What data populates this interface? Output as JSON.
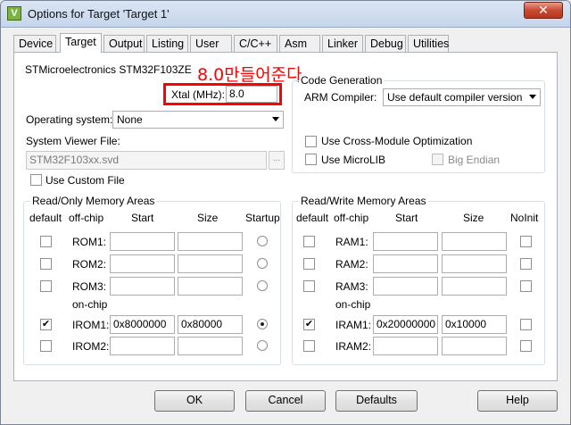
{
  "window": {
    "title": "Options for Target 'Target 1'",
    "close_label": "✕"
  },
  "tabs": [
    "Device",
    "Target",
    "Output",
    "Listing",
    "User",
    "C/C++",
    "Asm",
    "Linker",
    "Debug",
    "Utilities"
  ],
  "active_tab": "Target",
  "device": "STMicroelectronics STM32F103ZE",
  "annotation": "8.0만들어준다",
  "xtal": {
    "label": "Xtal (MHz):",
    "value": "8.0"
  },
  "os": {
    "label": "Operating system:",
    "value": "None"
  },
  "svd": {
    "label": "System Viewer File:",
    "value": "STM32F103xx.svd",
    "browse_label": "..."
  },
  "custom_file_label": "Use Custom File",
  "codegen": {
    "title": "Code Generation",
    "compiler_label": "ARM Compiler:",
    "compiler_value": "Use default compiler version",
    "cross_module_label": "Use Cross-Module Optimization",
    "microlib_label": "Use MicroLIB",
    "big_endian_label": "Big Endian"
  },
  "ro_memory": {
    "title": "Read/Only Memory Areas",
    "headers": {
      "default": "default",
      "offchip": "off-chip",
      "start": "Start",
      "size": "Size",
      "extra": "Startup"
    },
    "onchip_label": "on-chip",
    "rows": [
      {
        "name": "ROM1:",
        "start": "",
        "size": "",
        "default": false,
        "selected": false
      },
      {
        "name": "ROM2:",
        "start": "",
        "size": "",
        "default": false,
        "selected": false
      },
      {
        "name": "ROM3:",
        "start": "",
        "size": "",
        "default": false,
        "selected": false
      },
      {
        "name": "IROM1:",
        "start": "0x8000000",
        "size": "0x80000",
        "default": true,
        "selected": true
      },
      {
        "name": "IROM2:",
        "start": "",
        "size": "",
        "default": false,
        "selected": false
      }
    ]
  },
  "rw_memory": {
    "title": "Read/Write Memory Areas",
    "headers": {
      "default": "default",
      "offchip": "off-chip",
      "start": "Start",
      "size": "Size",
      "extra": "NoInit"
    },
    "onchip_label": "on-chip",
    "rows": [
      {
        "name": "RAM1:",
        "start": "",
        "size": "",
        "default": false,
        "noinit": false
      },
      {
        "name": "RAM2:",
        "start": "",
        "size": "",
        "default": false,
        "noinit": false
      },
      {
        "name": "RAM3:",
        "start": "",
        "size": "",
        "default": false,
        "noinit": false
      },
      {
        "name": "IRAM1:",
        "start": "0x20000000",
        "size": "0x10000",
        "default": true,
        "noinit": false
      },
      {
        "name": "IRAM2:",
        "start": "",
        "size": "",
        "default": false,
        "noinit": false
      }
    ]
  },
  "buttons": {
    "ok": "OK",
    "cancel": "Cancel",
    "defaults": "Defaults",
    "help": "Help"
  },
  "colors": {
    "highlight": "#ff0000",
    "title_gradient": "#c5d5ea",
    "close_button": "#c74a33"
  }
}
